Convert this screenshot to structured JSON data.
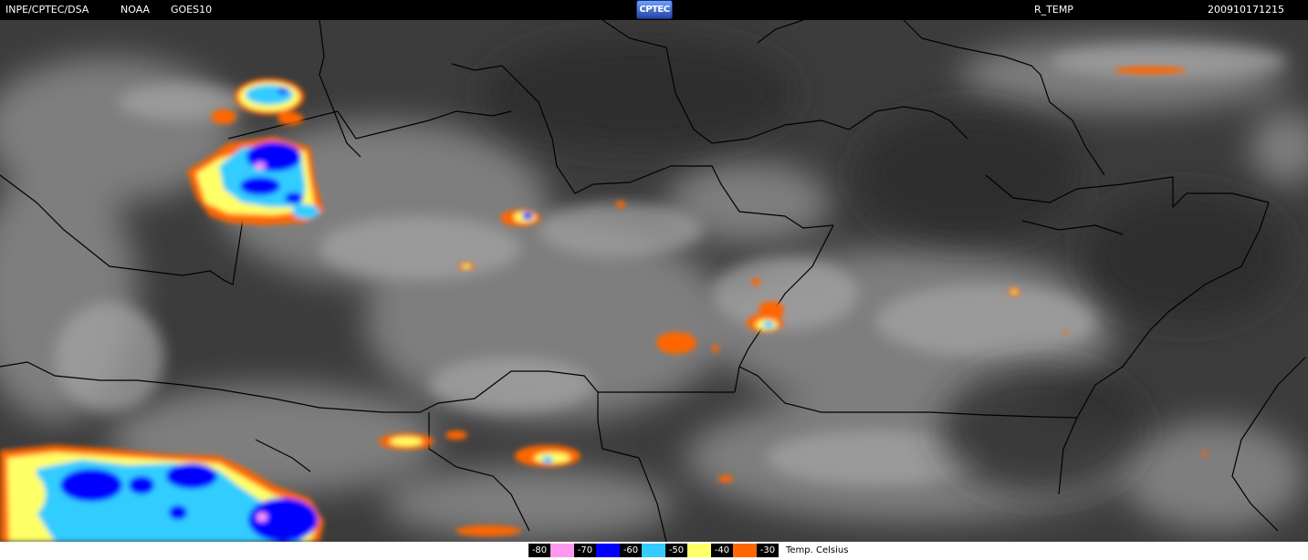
{
  "header": {
    "source": "INPE/CPTEC/DSA",
    "agency": "NOAA",
    "satellite": "GOES10",
    "logo_text": "CPTEC",
    "product": "R_TEMP",
    "timestamp": "200910171215"
  },
  "legend": {
    "unit_label": "Temp. Celsius",
    "items": [
      {
        "label": "-80",
        "color": "#ff99ee"
      },
      {
        "label": "-70",
        "color": "#0000ff"
      },
      {
        "label": "-60",
        "color": "#33ccff"
      },
      {
        "label": "-50",
        "color": "#ffff66"
      },
      {
        "label": "-40",
        "color": "#ff6600"
      },
      {
        "label": "-30",
        "color": "#ff6600"
      }
    ]
  },
  "colors": {
    "background": "#000000",
    "cloud_gray": "#9a9a9a",
    "land_gray": "#3a3a3a",
    "border_line": "#000000"
  }
}
